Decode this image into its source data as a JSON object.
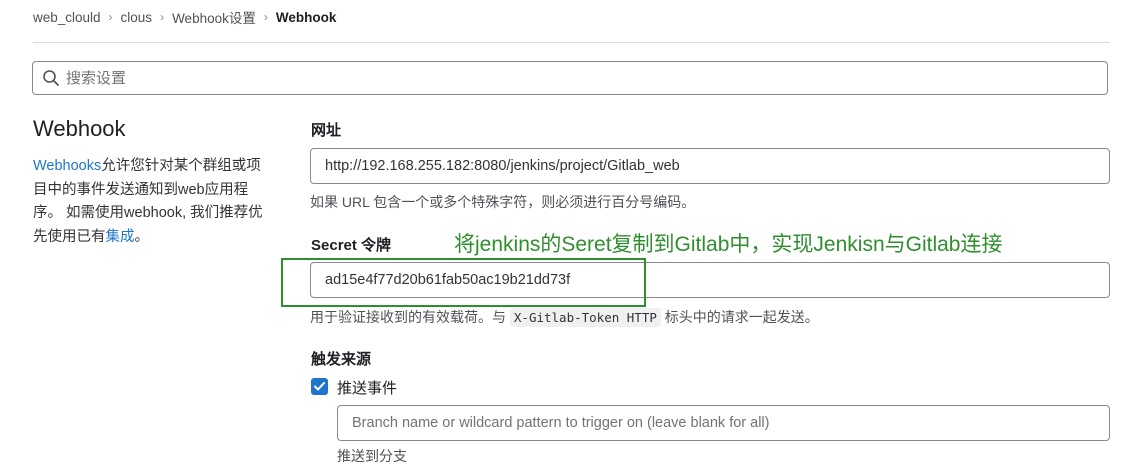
{
  "breadcrumb": {
    "items": [
      "web_clould",
      "clous",
      "Webhook设置",
      "Webhook"
    ]
  },
  "search": {
    "placeholder": "搜索设置"
  },
  "left": {
    "title": "Webhook",
    "desc_link": "Webhooks",
    "desc_text": "允许您针对某个群组或项目中的事件发送通知到web应用程序。 如需使用webhook, 我们推荐优先使用已有",
    "desc_link2": "集成",
    "desc_end": "。"
  },
  "url": {
    "label": "网址",
    "value": "http://192.168.255.182:8080/jenkins/project/Gitlab_web",
    "help": "如果 URL 包含一个或多个特殊字符，则必须进行百分号编码。"
  },
  "secret": {
    "label": "Secret 令牌",
    "value": "ad15e4f77d20b61fab50ac19b21dd73f",
    "help_before": "用于验证接收到的有效载荷。与",
    "help_code": "X-Gitlab-Token HTTP",
    "help_after": "标头中的请求一起发送。"
  },
  "annotation": "将jenkins的Seret复制到Gitlab中，实现Jenkisn与Gitlab连接",
  "trigger": {
    "label": "触发来源",
    "push_label": "推送事件",
    "push_checked": true,
    "branch_placeholder": "Branch name or wildcard pattern to trigger on (leave blank for all)",
    "cut_text": "推送到分支"
  },
  "colors": {
    "accent": "#1f75cb",
    "annotation": "#2f8f2f"
  }
}
